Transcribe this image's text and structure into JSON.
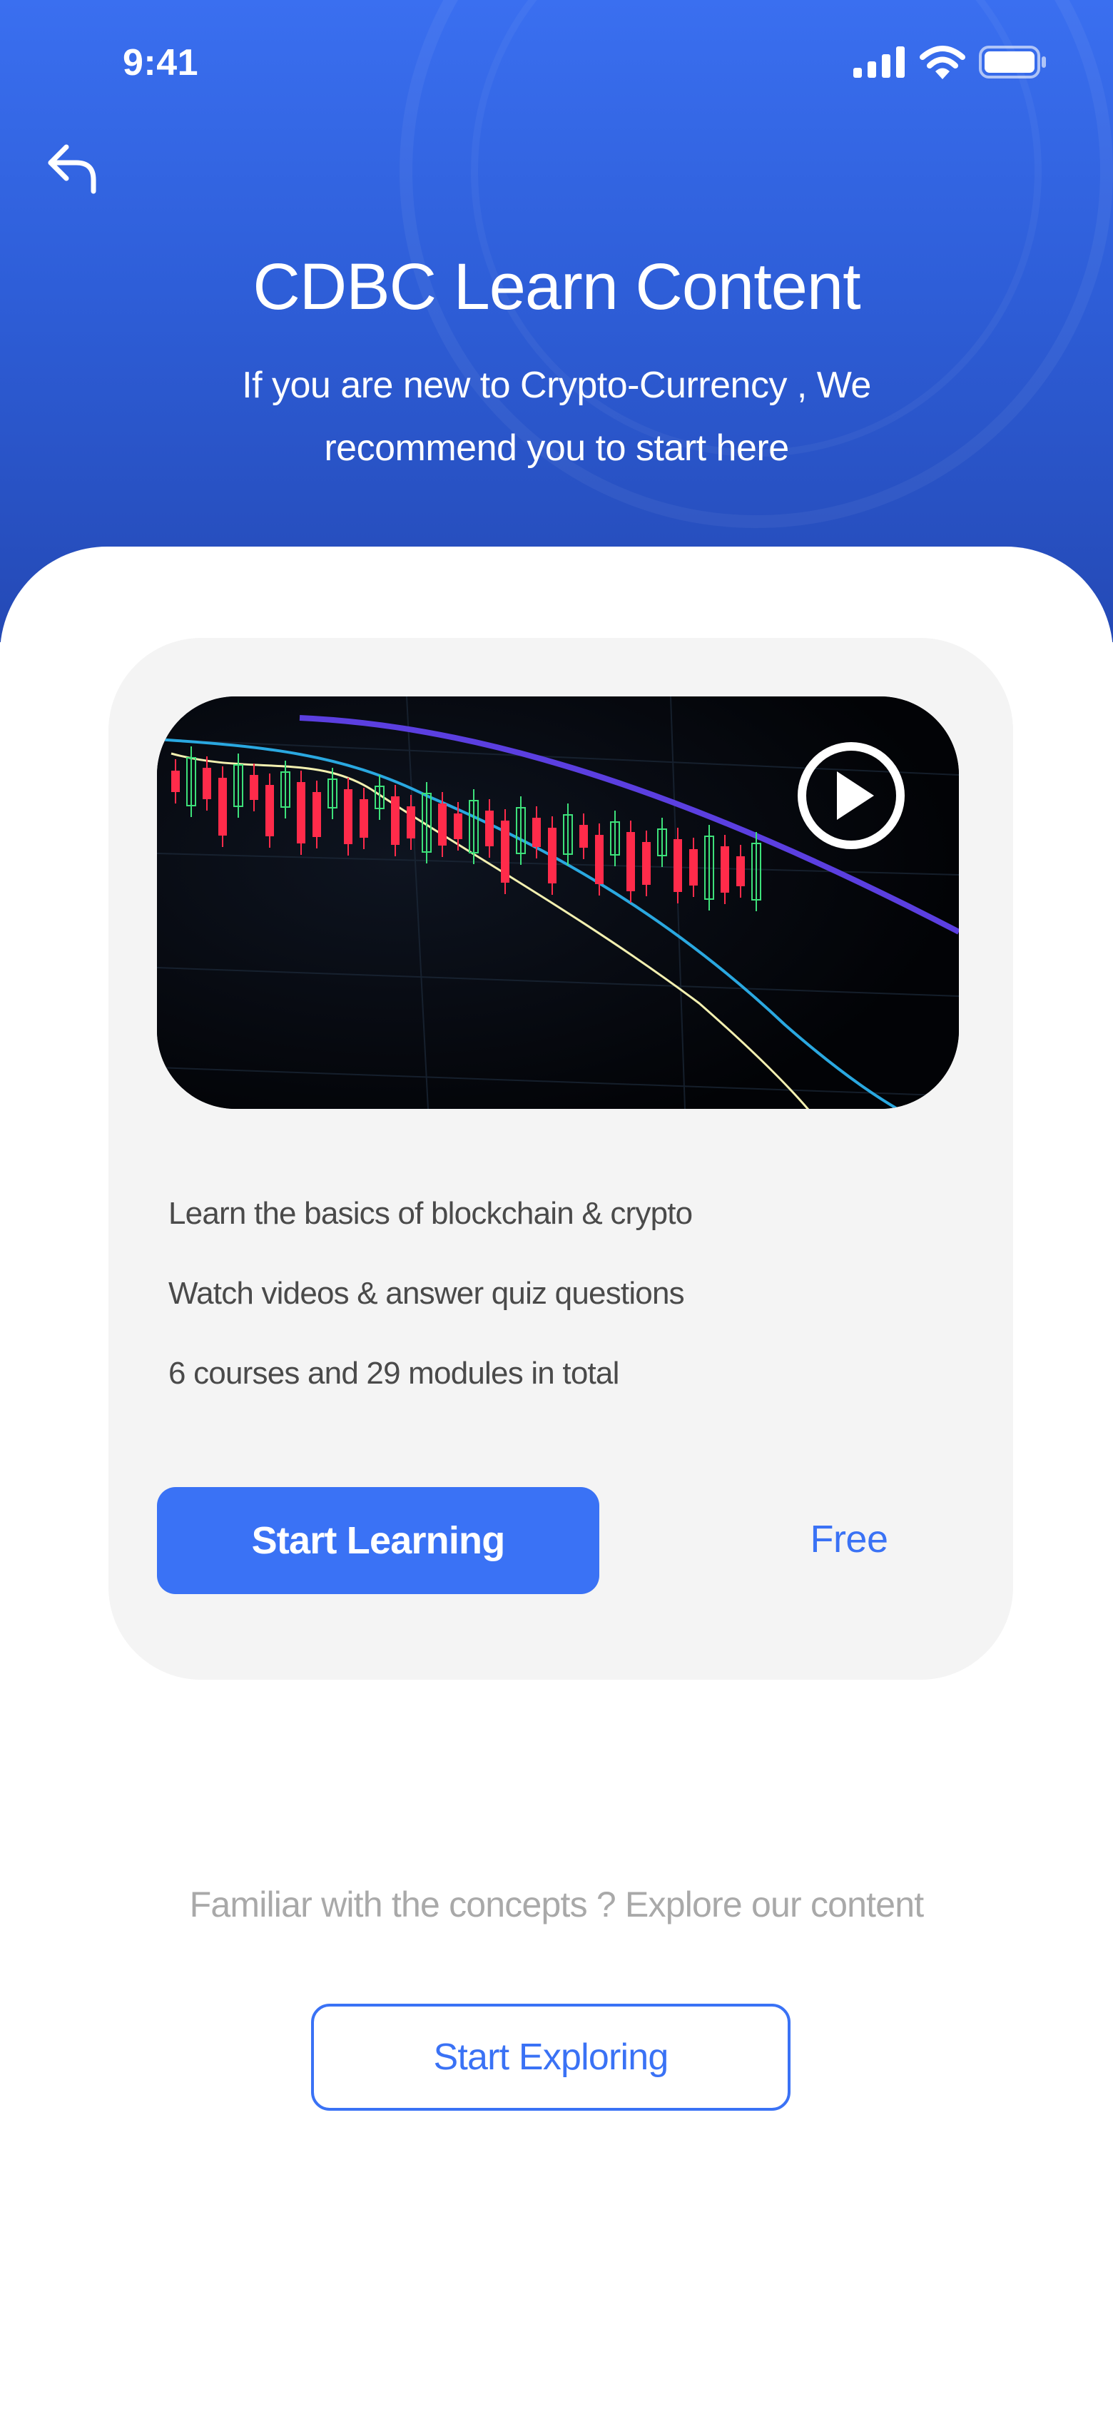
{
  "status_bar": {
    "time": "9:41",
    "icons": [
      "cellular-signal-icon",
      "wifi-icon",
      "battery-icon"
    ]
  },
  "header": {
    "back_icon": "back-arrow-icon",
    "title": "CDBC Learn Content",
    "subtitle_line1": "If you are new to Crypto-Currency , We",
    "subtitle_line2": "recommend you to start here"
  },
  "course_card": {
    "video": {
      "thumbnail": "candlestick-chart-image",
      "play_icon": "play-icon"
    },
    "features": [
      "Learn the basics of blockchain & crypto",
      "Watch videos & answer quiz questions",
      "6 courses and 29 modules in total"
    ],
    "cta_label": "Start Learning",
    "price": "Free"
  },
  "explore": {
    "prompt": "Familiar with the concepts ? Explore our content",
    "button_label": "Start Exploring"
  },
  "colors": {
    "header_gradient_top": "#3a6ff0",
    "header_gradient_bottom": "#2449b5",
    "accent": "#3a72f5",
    "card_background": "#f4f4f4",
    "muted_text": "#a9a9a9",
    "body_text": "#4a4a4a"
  }
}
